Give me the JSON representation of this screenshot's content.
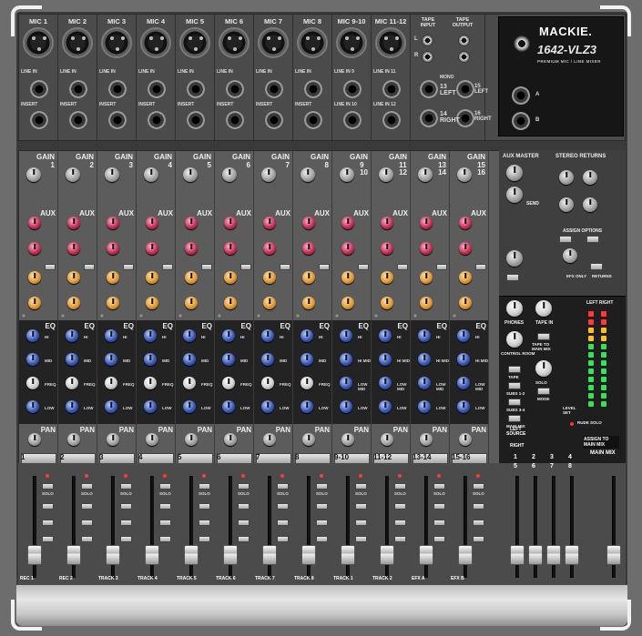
{
  "mixer": {
    "brand": "MACKIE.",
    "model": "1642-VLZ3",
    "subtitle": "PREMIUM MIC / LINE MIXER"
  },
  "top_inputs": {
    "mic_labels": [
      "MIC 1",
      "MIC 2",
      "MIC 3",
      "MIC 4",
      "MIC 5",
      "MIC 6",
      "MIC 7",
      "MIC 8",
      "MIC 9-10",
      "MIC 11-12"
    ],
    "line_in": "LINE IN",
    "insert": "INSERT",
    "line_in_9": "LINE IN 9",
    "line_in_10": "LINE IN 10",
    "line_in_11": "LINE IN 11",
    "line_in_12": "LINE IN 12",
    "mono": "MONO",
    "left_13": "13 LEFT",
    "right_14": "14 RIGHT",
    "left_15": "15 LEFT",
    "right_16": "16 RIGHT",
    "tape_input": "TAPE INPUT",
    "tape_output": "TAPE OUTPUT",
    "l": "L",
    "r": "R",
    "a": "A",
    "b": "B"
  },
  "channels": {
    "gain_label": "GAIN",
    "aux_label": "AUX",
    "eq_label": "EQ",
    "pan_label": "PAN",
    "mute_label": "MUTE",
    "solo_label": "SOLO",
    "numbers": [
      "1",
      "2",
      "3",
      "4",
      "5",
      "6",
      "7",
      "8",
      "9\n10",
      "11\n12",
      "13\n14",
      "15\n16"
    ],
    "mute_numbers": [
      "1",
      "2",
      "3",
      "4",
      "5",
      "6",
      "7",
      "8",
      "9-10",
      "11-12",
      "13-14",
      "15-16"
    ],
    "eq_hi": "HI",
    "eq_mid": "MID",
    "eq_freq": "FREQ",
    "eq_low": "LOW",
    "eq_lowmid": "LOW MID",
    "eq_himid": "HI MID"
  },
  "faders": {
    "bottom_labels": [
      "REC 1",
      "REC 2",
      "TRACK 3",
      "TRACK 4",
      "TRACK 5",
      "TRACK 6",
      "TRACK 7",
      "TRACK 8",
      "TRACK 1",
      "TRACK 2",
      "EFX A",
      "EFX B"
    ],
    "sub_labels": [
      "1",
      "2",
      "3",
      "4"
    ],
    "sub_labels_b": [
      "5",
      "6",
      "7",
      "8"
    ],
    "main_mix": "MAIN MIX",
    "assign_to_main_mix": "ASSIGN TO MAIN MIX",
    "left": "LEFT",
    "right": "RIGHT"
  },
  "master": {
    "aux_master": "AUX MASTER",
    "stereo_returns": "STEREO RETURNS",
    "send": "SEND",
    "assign_options": "ASSIGN OPTIONS",
    "phones": "PHONES",
    "tape_in": "TAPE IN",
    "control_room": "CONTROL ROOM",
    "tape_to_main_mix": "TAPE TO MAIN MIX",
    "max": "MAX",
    "tape": "TAPE",
    "subs_12": "SUBS 1-2",
    "subs_34": "SUBS 3-4",
    "main_mix": "MAIN MIX",
    "source": "SOURCE",
    "level_set": "LEVEL SET",
    "rude_solo": "RUDE SOLO",
    "mode": "MODE",
    "left_right": "LEFT RIGHT",
    "solo": "SOLO",
    "returns": "RETURNS",
    "efx_only": "EFX ONLY"
  },
  "colors": {
    "panel": "#5c5c5c",
    "dark_panel": "#232323",
    "aux_knob": "#c4305a",
    "eq_knob": "#3c59b8",
    "orange_knob": "#e29a36"
  }
}
